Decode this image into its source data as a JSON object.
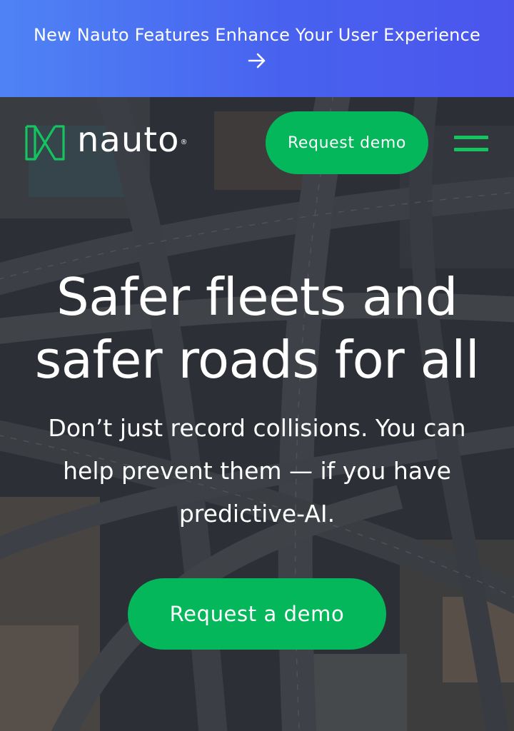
{
  "announcement": {
    "text": "New Nauto Features Enhance Your User Experience",
    "arrow_icon": "arrow-right-icon"
  },
  "header": {
    "logo_text": "nauto",
    "logo_registered": "®",
    "logo_icon": "nauto-n-logo-icon",
    "demo_button_label": "Request demo",
    "menu_icon": "hamburger-menu-icon"
  },
  "hero": {
    "title": "Safer fleets and\nsafer roads for all",
    "subtitle": "Don’t just record collisions. You can help prevent them — if you have predictive-AI.",
    "cta_label": "Request a demo",
    "background": "aerial-highway-interchange-image"
  },
  "colors": {
    "banner_start": "#4f83f5",
    "banner_end": "#4b55ec",
    "brand_green": "#04b75b",
    "menu_green": "#14c55f",
    "text": "#ffffff"
  }
}
